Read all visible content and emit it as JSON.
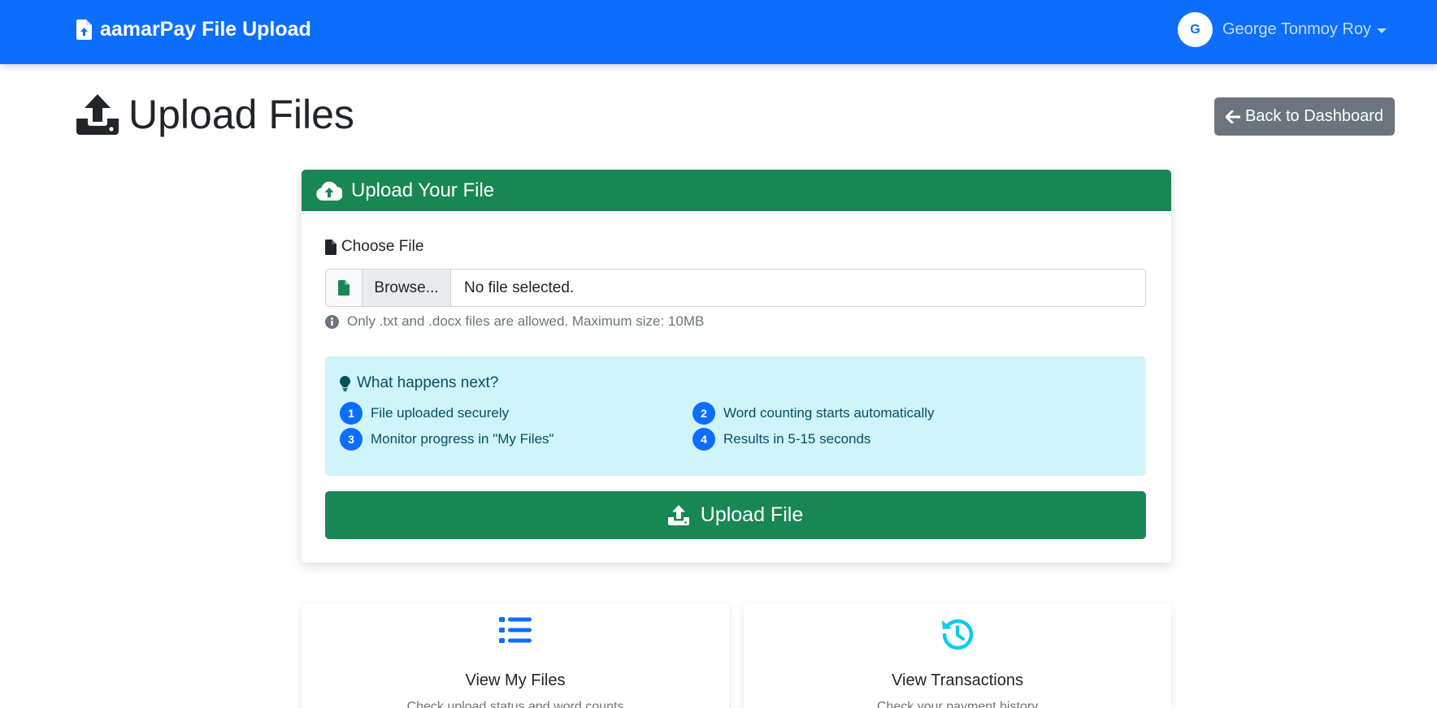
{
  "navbar": {
    "brand": "aamarPay File Upload",
    "avatar_initial": "G",
    "user_name": "George Tonmoy Roy"
  },
  "page": {
    "title": "Upload Files",
    "back_button": "Back to Dashboard"
  },
  "upload_card": {
    "header": "Upload Your File",
    "field_label": "Choose File",
    "browse_label": "Browse...",
    "file_status": "No file selected.",
    "help_text": "Only .txt and .docx files are allowed. Maximum size: 10MB",
    "info": {
      "title": "What happens next?",
      "steps": [
        {
          "num": "1",
          "text": "File uploaded securely"
        },
        {
          "num": "2",
          "text": "Word counting starts automatically"
        },
        {
          "num": "3",
          "text": "Monitor progress in \"My Files\""
        },
        {
          "num": "4",
          "text": "Results in 5-15 seconds"
        }
      ]
    },
    "submit_label": "Upload File"
  },
  "quick_links": [
    {
      "title": "View My Files",
      "description": "Check upload status and word counts",
      "icon": "list-icon"
    },
    {
      "title": "View Transactions",
      "description": "Check your payment history",
      "icon": "history-icon"
    }
  ],
  "colors": {
    "primary": "#0d6efd",
    "success": "#198754",
    "secondary": "#6c757d",
    "info_bg": "#cff4fc",
    "info_text": "#055160",
    "cyan": "#0dcaf0"
  }
}
